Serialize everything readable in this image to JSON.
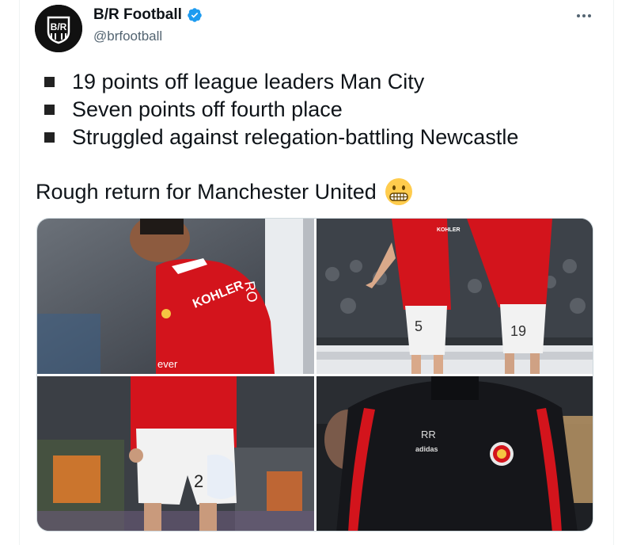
{
  "tweet": {
    "author": {
      "display_name": "B/R Football",
      "handle": "@brfootball",
      "verified": true,
      "avatar_icon": "br-logo-icon"
    },
    "more_icon": "more-options-icon",
    "bullets": [
      "19 points off league leaders Man City",
      "Seven points off fourth place",
      "Struggled against relegation-battling Newcastle"
    ],
    "text": "Rough return for Manchester United",
    "emoji": "grimacing-face-emoji",
    "photos": {
      "top_left": {
        "sponsor": "KOHLER",
        "sleeve": "RO",
        "sleeve_ad": "ever"
      },
      "top_right": {
        "player_a_number": "5",
        "player_b_number": "19",
        "sponsor": "KOHLER"
      },
      "bottom_left": {
        "shorts_number": "2"
      },
      "bottom_right": {
        "initials": "RR",
        "brand": "adidas"
      }
    }
  },
  "colors": {
    "verified": "#1d9bf0",
    "text": "#0f1419",
    "secondary": "#536471",
    "united_red": "#d3141c"
  }
}
